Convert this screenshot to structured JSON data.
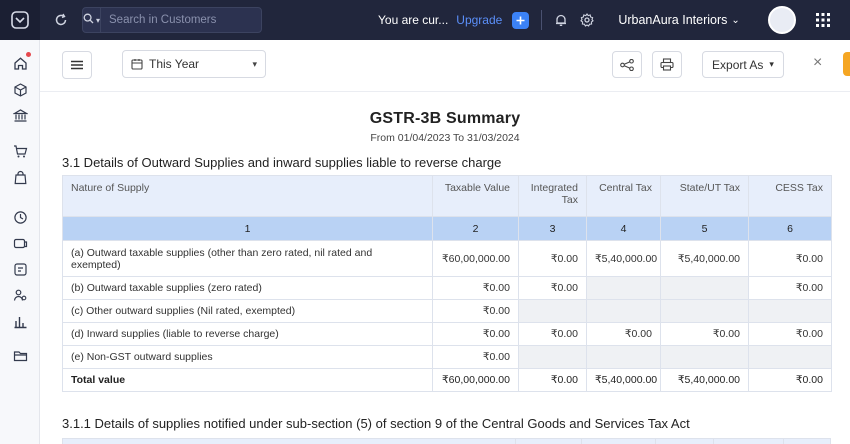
{
  "topbar": {
    "search_placeholder": "Search in Customers",
    "notice": "You are cur...",
    "upgrade_label": "Upgrade",
    "org_name": "UrbanAura Interiors",
    "org_caret": "⌄"
  },
  "toolbar": {
    "period_label": "This Year",
    "export_label": "Export As",
    "caret": "▾",
    "close_glyph": "×"
  },
  "report": {
    "title": "GSTR-3B Summary",
    "subtitle": "From 01/04/2023  To 31/03/2024",
    "section1_heading": "3.1 Details of Outward Supplies and inward supplies liable to reverse charge",
    "section2_heading": "3.1.1 Details of supplies notified under sub-section (5) of section 9 of the Central Goods and Services Tax Act",
    "columns": [
      "Nature of Supply",
      "Taxable Value",
      "Integrated Tax",
      "Central Tax",
      "State/UT Tax",
      "CESS Tax"
    ],
    "column_numbers": [
      "1",
      "2",
      "3",
      "4",
      "5",
      "6"
    ],
    "rows": [
      {
        "nature": "(a) Outward taxable supplies (other than zero rated, nil rated and exempted)",
        "taxable": "₹60,00,000.00",
        "integrated": "₹0.00",
        "central": "₹5,40,000.00",
        "state": "₹5,40,000.00",
        "cess": "₹0.00"
      },
      {
        "nature": "(b) Outward taxable supplies (zero rated)",
        "taxable": "₹0.00",
        "integrated": "₹0.00",
        "central": "",
        "state": "",
        "cess": "₹0.00"
      },
      {
        "nature": "(c) Other outward supplies (Nil rated, exempted)",
        "taxable": "₹0.00",
        "integrated": "",
        "central": "",
        "state": "",
        "cess": ""
      },
      {
        "nature": "(d) Inward supplies (liable to reverse charge)",
        "taxable": "₹0.00",
        "integrated": "₹0.00",
        "central": "₹0.00",
        "state": "₹0.00",
        "cess": "₹0.00"
      },
      {
        "nature": "(e) Non-GST outward supplies",
        "taxable": "₹0.00",
        "integrated": "",
        "central": "",
        "state": "",
        "cess": ""
      }
    ],
    "total": {
      "nature": "Total value",
      "taxable": "₹60,00,000.00",
      "integrated": "₹0.00",
      "central": "₹5,40,000.00",
      "state": "₹5,40,000.00",
      "cess": "₹0.00"
    }
  },
  "colors": {
    "topbar_bg": "#21263c",
    "accent_blue": "#3b82f6",
    "header_cell_bg": "#e7eefb",
    "number_row_bg": "#b9d2f4",
    "orange_accent": "#f5a623"
  },
  "icons": {
    "topbar": [
      "logo-icon",
      "refresh-icon",
      "search-icon",
      "plus-icon",
      "bell-icon",
      "gear-icon",
      "apps-grid-icon"
    ],
    "sidebar": [
      "home-icon",
      "box-icon",
      "bank-icon",
      "cart-icon",
      "bag-icon",
      "clock-icon",
      "card-icon",
      "folder-doc-icon",
      "users-icon",
      "bar-chart-icon",
      "folder-icon"
    ],
    "toolbar": [
      "menu-icon",
      "calendar-icon",
      "share-icon",
      "printer-icon",
      "close-icon"
    ]
  }
}
